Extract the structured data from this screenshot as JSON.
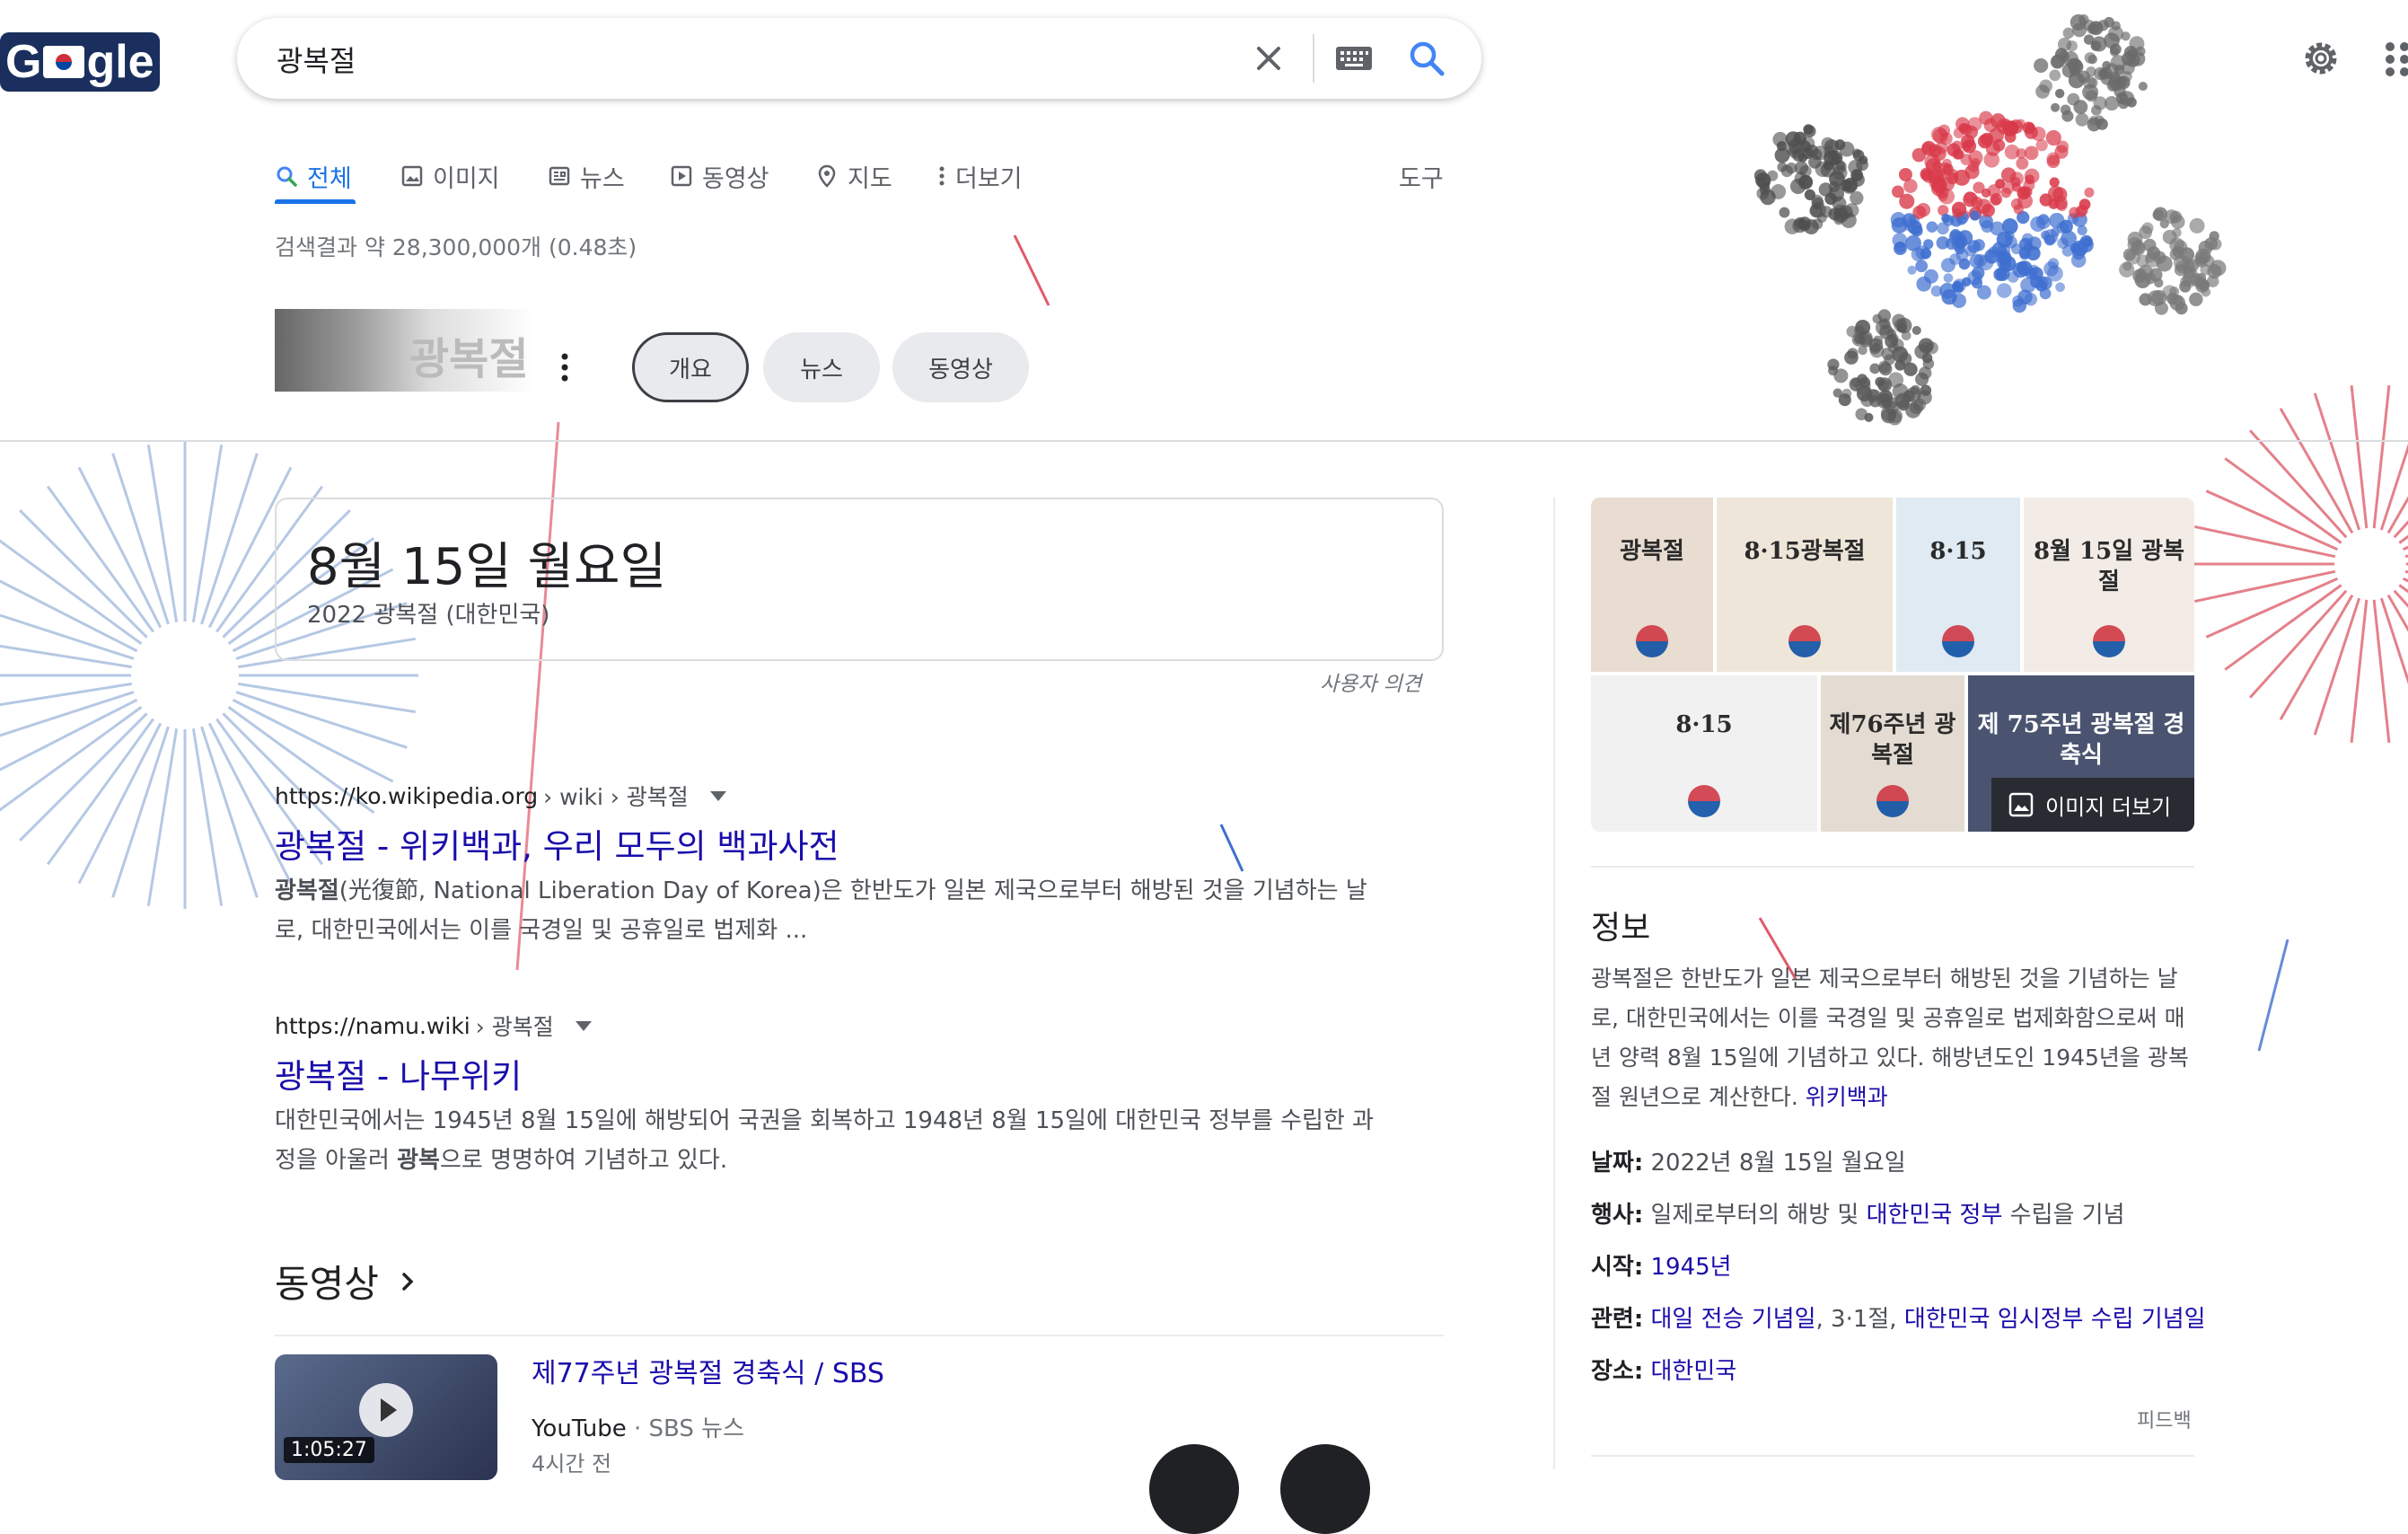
{
  "logo": {
    "letters_before": "G",
    "letters_after": "gle"
  },
  "search": {
    "query": "광복절",
    "clear_label": "×"
  },
  "tabs": [
    {
      "label": "전체"
    },
    {
      "label": "이미지"
    },
    {
      "label": "뉴스"
    },
    {
      "label": "동영상"
    },
    {
      "label": "지도"
    },
    {
      "label": "더보기"
    }
  ],
  "tools_label": "도구",
  "result_stats": "검색결과 약 28,300,000개 (0.48초)",
  "hero_thumb_text": "광복절",
  "chips": [
    {
      "label": "개요",
      "selected": true
    },
    {
      "label": "뉴스",
      "selected": false
    },
    {
      "label": "동영상",
      "selected": false
    }
  ],
  "date_card": {
    "date": "8월 15일 월요일",
    "subtitle": "2022 광복절 (대한민국)",
    "feedback": "사용자 의견"
  },
  "results": [
    {
      "site": "https://ko.wikipedia.org",
      "path": " › wiki › 광복절",
      "title": "광복절 - 위키백과, 우리 모두의 백과사전",
      "snippet_bold": "광복절",
      "snippet_line1": "(光復節, National Liberation Day of Korea)은 한반도가 일본 제국으로부터 해방된 것을 기념하는 날",
      "snippet_line2": "로, 대한민국에서는 이를 국경일 및 공휴일로 법제화 ..."
    },
    {
      "site": "https://namu.wiki",
      "path": " › 광복절",
      "title": "광복절 - 나무위키",
      "snippet_line1": "대한민국에서는 1945년 8월 15일에 해방되어 국권을 회복하고 1948년 8월 15일에 대한민국 정부를 수립한 과",
      "snippet_line2_pre": "정을 아울러 ",
      "snippet_line2_bold": "광복",
      "snippet_line2_post": "으로 명명하여 기념하고 있다."
    }
  ],
  "videos_section": {
    "title": "동영상",
    "item": {
      "title": "제77주년 광복절 경축식 / SBS",
      "platform": "YouTube",
      "channel": " · SBS 뉴스",
      "time": "4시간 전",
      "duration": "1:05:27"
    }
  },
  "knowledge_panel": {
    "image_tiles": [
      {
        "text": "광복절",
        "bg": "#e9dcd0"
      },
      {
        "text": "8·15광복절",
        "bg": "#efe6da"
      },
      {
        "text": "8·15",
        "bg": "#dfeaf3"
      },
      {
        "text": "8월 15일 광복절",
        "bg": "#f3ece6"
      },
      {
        "text": "8·15",
        "bg": "#f1f1f1"
      },
      {
        "text": "제76주년 광복절",
        "bg": "#e4dcd2"
      },
      {
        "text": "제 75주년 광복절 경축식",
        "bg": "#4a5470"
      }
    ],
    "more_images_label": "이미지 더보기",
    "heading": "정보",
    "description": "광복절은 한반도가 일본 제국으로부터 해방된 것을 기념하는 날로, 대한민국에서는 이를 국경일 및 공휴일로 법제화함으로써 매년 양력 8월 15일에 기념하고 있다. 해방년도인 1945년을 광복절 원년으로 계산한다.",
    "description_source": "위키백과",
    "facts": {
      "date_label": "날짜:",
      "date_value": "2022년 8월 15일 월요일",
      "event_label": "행사:",
      "event_pre": "일제로부터의 해방 및 ",
      "event_link": "대한민국 정부",
      "event_post": " 수립을 기념",
      "start_label": "시작:",
      "start_value": "1945년",
      "related_label": "관련:",
      "related_1": "대일 전승 기념일",
      "related_sep1": ", 3·1절, ",
      "related_2": "대한민국 임시정부 수립 기념일",
      "place_label": "장소:",
      "place_value": "대한민국"
    },
    "feedback": "피드백"
  },
  "colors": {
    "link": "#1a0dab",
    "accent": "#1a73e8",
    "firework_red": "#d93a4a",
    "firework_blue": "#3f6fd0"
  }
}
